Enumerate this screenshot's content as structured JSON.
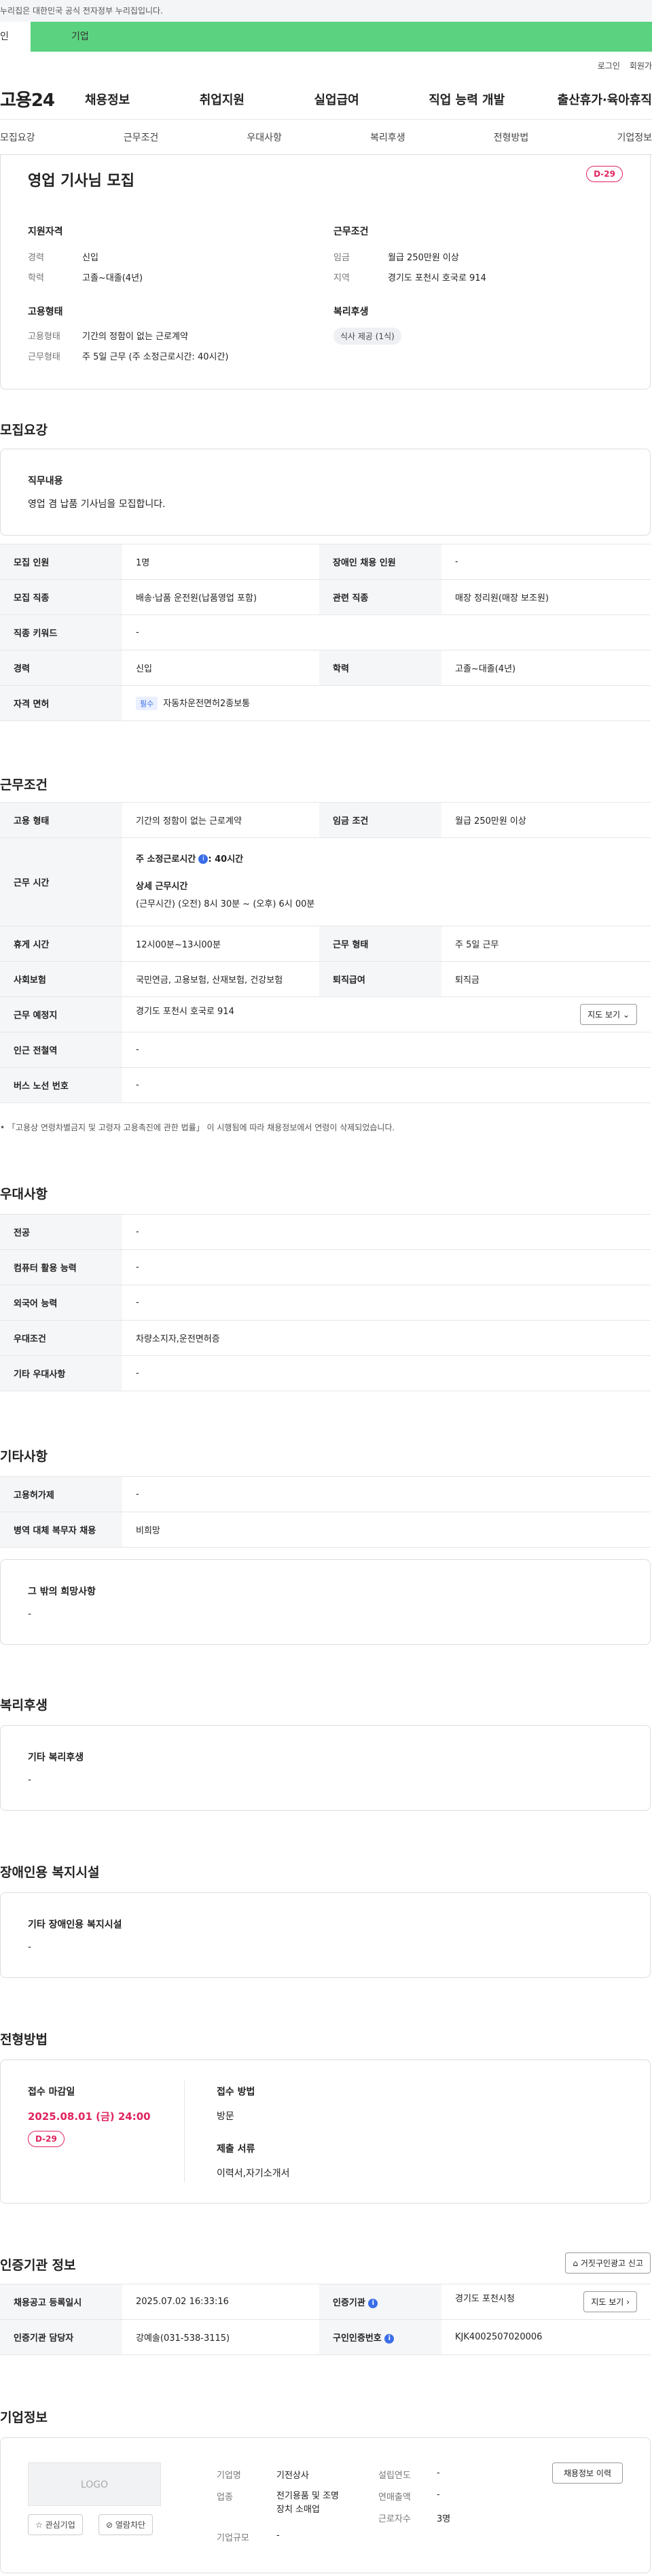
{
  "banner": {
    "text": "누리집은 대한민국 공식 전자정부 누리집입니다."
  },
  "tabs": [
    "인",
    "기업"
  ],
  "util": {
    "login": "로그인",
    "signup": "회원가"
  },
  "gnb": {
    "logo": "고용24",
    "menu": [
      "채용정보",
      "취업지원",
      "실업급여",
      "직업 능력 개발",
      "출산휴가·육아휴직"
    ]
  },
  "anchor": [
    "모집요강",
    "근무조건",
    "우대사항",
    "복리후생",
    "전형방법",
    "기업정보"
  ],
  "summary": {
    "title": "영업 기사님 모집",
    "dday": "D-29",
    "qual_title": "지원자격",
    "exp_k": "경력",
    "exp_v": "신입",
    "edu_k": "학력",
    "edu_v": "고졸~대졸(4년)",
    "cond_title": "근무조건",
    "wage_k": "임금",
    "wage_v": "월급 250만원 이상",
    "area_k": "지역",
    "area_v": "경기도 포천시 호국로 914",
    "emp_title": "고용형태",
    "emp_k": "고용형태",
    "emp_v": "기간의 정함이 없는 근로계약",
    "work_k": "근무형태",
    "work_v": "주 5일 근무 (주 소정근로시간: 40시간)",
    "welfare_title": "복리후생",
    "welfare_pill": "식사 제공 (1식)"
  },
  "recruit": {
    "title": "모집요강",
    "duty_title": "직무내용",
    "duty_text": "영업 겸 납품 기사님을 모집합니다.",
    "rows": [
      [
        "모집 인원",
        "1명",
        "장애인 채용 인원",
        "-"
      ],
      [
        "모집 직종",
        "배송·납품 운전원(납품영업 포함)",
        "관련 직종",
        "매장 정리원(매장 보조원)"
      ]
    ],
    "kw_k": "직종 키워드",
    "kw_v": "-",
    "career_k": "경력",
    "career_v": "신입",
    "edu_k": "학력",
    "edu_v": "고졸~대졸(4년)",
    "lic_k": "자격 면허",
    "lic_tag": "필수",
    "lic_v": "자동차운전면허2종보통"
  },
  "cond": {
    "title": "근무조건",
    "emp_k": "고용 형태",
    "emp_v": "기간의 정함이 없는 근로계약",
    "wage_k": "임금 조건",
    "wage_v": "월급 250만원 이상",
    "time_k": "근무 시간",
    "time_l1a": "주 소정근로시간",
    "time_l1b": ": 40시간",
    "time_l2": "상세 근무시간",
    "time_l3": "(근무시간) (오전) 8시 30분 ~ (오후) 6시 00분",
    "rest_k": "휴게 시간",
    "rest_v": "12시00분~13시00분",
    "shape_k": "근무 형태",
    "shape_v": "주 5일 근무",
    "ins_k": "사회보험",
    "ins_v": "국민연금, 고용보험, 산재보험, 건강보험",
    "sev_k": "퇴직급여",
    "sev_v": "퇴직금",
    "place_k": "근무 예정지",
    "place_v": "경기도 포천시 호국로 914",
    "map_btn": "지도 보기",
    "sub_k": "인근 전철역",
    "sub_v": "-",
    "bus_k": "버스 노선 번호",
    "bus_v": "-",
    "note": "「고용상 연령차별금지 및 고령자 고용촉진에 관한 법률」 이 시행됨에 따라 채용정보에서 연령이 삭제되었습니다."
  },
  "pref": {
    "title": "우대사항",
    "rows": [
      [
        "전공",
        "-"
      ],
      [
        "컴퓨터 활용 능력",
        "-"
      ],
      [
        "외국어 능력",
        "-"
      ],
      [
        "우대조건",
        "차량소지자,운전면허증"
      ],
      [
        "기타 우대사항",
        "-"
      ]
    ]
  },
  "etc": {
    "title": "기타사항",
    "rows": [
      [
        "고용허가제",
        "-"
      ],
      [
        "병역 대체 복무자 채용",
        "비희망"
      ]
    ],
    "box_title": "그 밖의 희망사항",
    "box_v": "-"
  },
  "welfare": {
    "title": "복리후생",
    "box_title": "기타 복리후생",
    "box_v": "-"
  },
  "disab": {
    "title": "장애인용 복지시설",
    "box_title": "기타 장애인용 복지시설",
    "box_v": "-"
  },
  "process": {
    "title": "전형방법",
    "deadline_k": "접수 마감일",
    "deadline_v": "2025.08.01 (금) 24:00",
    "dday": "D-29",
    "method_k": "접수 방법",
    "method_v": "방문",
    "docs_k": "제출 서류",
    "docs_v": "이력서,자기소개서"
  },
  "cert": {
    "title": "인증기관 정보",
    "report_btn": "거짓구인광고 신고",
    "reg_k": "채용공고 등록일시",
    "reg_v": "2025.07.02 16:33:16",
    "org_k": "인증기관",
    "org_v": "경기도 포천시청",
    "map_btn": "지도 보기",
    "mgr_k": "인증기관 담당자",
    "mgr_v": "강예솔(031-538-3115)",
    "no_k": "구인인증번호",
    "no_v": "KJK4002507020006"
  },
  "company": {
    "title": "기업정보",
    "logo": "LOGO",
    "fav": "관심기업",
    "block": "열람차단",
    "name_k": "기업명",
    "name_v": "기전상사",
    "ind_k": "업종",
    "ind_v1": "전기용품 및 조명",
    "ind_v2": "장치 소매업",
    "size_k": "기업규모",
    "size_v": "-",
    "year_k": "설립연도",
    "year_v": "-",
    "sales_k": "연매출액",
    "sales_v": "-",
    "emp_k": "근로자수",
    "emp_v": "3명",
    "hist_btn": "채용정보 이력"
  }
}
